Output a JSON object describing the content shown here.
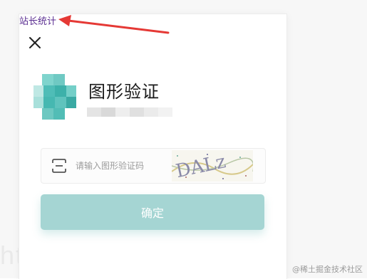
{
  "top_link": {
    "label": "站长统计"
  },
  "dialog": {
    "title": "图形验证",
    "captcha": {
      "placeholder": "请输入图形验证码",
      "value": "",
      "image_text": "DALz"
    },
    "confirm_label": "确定"
  },
  "watermarks": {
    "background_text": "htt                                    bale_H",
    "corner_text": "@稀土掘金技术社区"
  },
  "colors": {
    "accent": "#a5d5d3",
    "avatar_teal": "#4fbdb7",
    "link": "#5a2d91",
    "arrow": "#e53935"
  },
  "icons": {
    "close": "close-icon",
    "captcha": "captcha-icon",
    "arrow": "red-arrow-annotation"
  }
}
